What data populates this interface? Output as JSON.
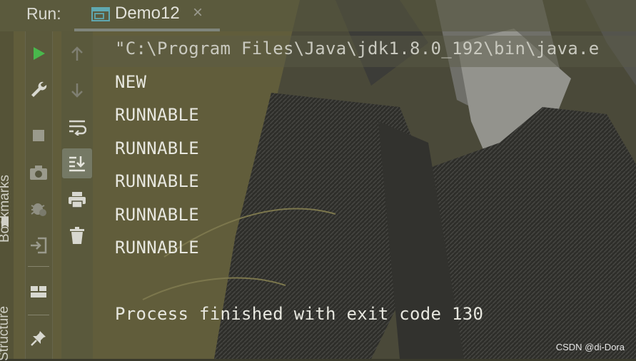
{
  "header": {
    "run_label": "Run:",
    "tab": {
      "title": "Demo12",
      "close": "×"
    }
  },
  "left_strip": {
    "bookmarks": "Bookmarks",
    "structure": "Structure"
  },
  "toolbar": {
    "column1": [
      "run-icon",
      "wrench-icon",
      "stop-icon",
      "camera-icon",
      "debug-icon",
      "login-icon",
      "layout-icon",
      "pin-icon"
    ],
    "column2": [
      "arrow-up-icon",
      "arrow-down-icon",
      "soft-wrap-icon",
      "scroll-to-end-icon",
      "print-icon",
      "trash-icon"
    ]
  },
  "console": {
    "command": "\"C:\\Program Files\\Java\\jdk1.8.0_192\\bin\\java.e",
    "lines": [
      "NEW",
      "RUNNABLE",
      "RUNNABLE",
      "RUNNABLE",
      "RUNNABLE",
      "RUNNABLE"
    ],
    "exit": "Process finished with exit code 130"
  },
  "watermark": "CSDN @di-Dora",
  "colors": {
    "run_green": "#49b84c",
    "text": "#e7e7df",
    "panel": "#56563e"
  }
}
